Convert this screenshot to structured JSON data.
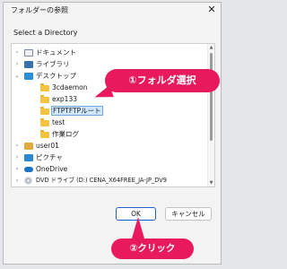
{
  "window": {
    "title": "フォルダーの参照",
    "close_glyph": "✕"
  },
  "prompt": "Select a Directory",
  "tree": [
    {
      "label": "ドキュメント",
      "icon": "document-folder-icon",
      "chevron": "›"
    },
    {
      "label": "ライブラリ",
      "icon": "library-icon",
      "chevron": "›"
    },
    {
      "label": "デスクトップ",
      "icon": "desktop-icon",
      "chevron": "⌄"
    },
    {
      "label": "3cdaemon",
      "icon": "folder-icon",
      "chevron": ""
    },
    {
      "label": "exp133",
      "icon": "folder-icon",
      "chevron": ""
    },
    {
      "label": "FTPTFTPルート",
      "icon": "folder-icon",
      "chevron": "",
      "selected": true
    },
    {
      "label": "test",
      "icon": "folder-icon",
      "chevron": ""
    },
    {
      "label": "作業ログ",
      "icon": "folder-icon",
      "chevron": ""
    },
    {
      "label": "user01",
      "icon": "user-folder-icon",
      "chevron": "›"
    },
    {
      "label": "ピクチャ",
      "icon": "pictures-icon",
      "chevron": "›"
    },
    {
      "label": "OneDrive",
      "icon": "onedrive-icon",
      "chevron": "›"
    },
    {
      "label": "DVD ドライブ (D:) CENA_X64FREE_JA-JP_DV9",
      "icon": "dvd-drive-icon",
      "chevron": "›"
    }
  ],
  "buttons": {
    "ok": "OK",
    "cancel": "キャンセル"
  },
  "annotations": {
    "step1": "①フォルダ選択",
    "step2": "②クリック"
  },
  "colors": {
    "annotation": "#e8195c",
    "ok_border": "#1d5fd0",
    "selection": "#cfe6fb"
  }
}
